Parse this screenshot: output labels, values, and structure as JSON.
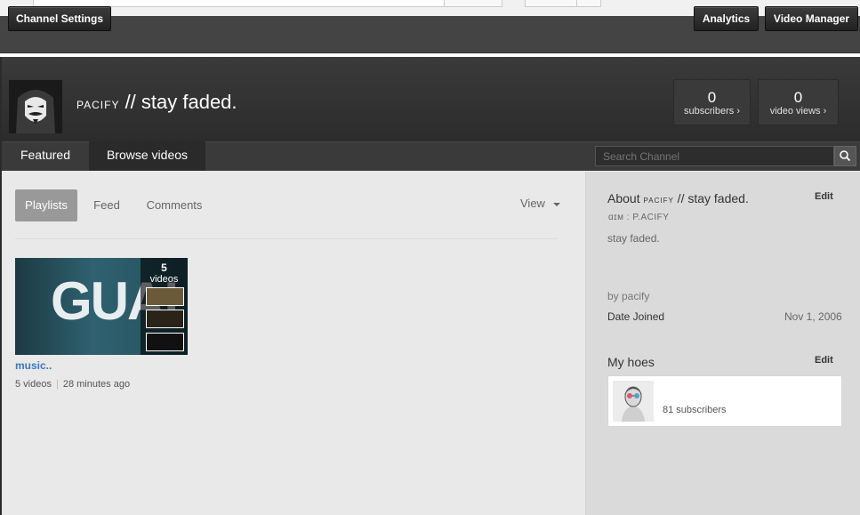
{
  "owner_bar": {
    "channel_settings": "Channel Settings",
    "analytics": "Analytics",
    "video_manager": "Video Manager"
  },
  "channel": {
    "name_smallcaps": "pacify",
    "name_rest": " // stay faded.",
    "subscribers": {
      "count": "0",
      "label": "subscribers ›"
    },
    "video_views": {
      "count": "0",
      "label": "video views ›"
    }
  },
  "nav": {
    "tabs": [
      {
        "label": "Featured"
      },
      {
        "label": "Browse videos"
      }
    ],
    "search_placeholder": "Search Channel"
  },
  "main": {
    "subtabs": [
      {
        "label": "Playlists"
      },
      {
        "label": "Feed"
      },
      {
        "label": "Comments"
      }
    ],
    "view_label": "View",
    "playlist": {
      "thumb_text": "GUAI",
      "count": "5",
      "count_label": "videos",
      "title": "music..",
      "videos": "5 videos",
      "age": "28 minutes ago"
    }
  },
  "sidebar": {
    "about_prefix": "About ",
    "about_smallcaps": "pacify",
    "about_rest": " // stay faded.",
    "about_edit": "Edit",
    "handle": "ɑɪᴍ : P.ACIFY",
    "description": "stay faded.",
    "by": "by pacify",
    "date_joined_label": "Date Joined",
    "date_joined_value": "Nov 1, 2006",
    "hoes_title": "My hoes",
    "hoes_edit": "Edit",
    "hoes_subscribers": "81 subscribers"
  },
  "colors": {
    "owner_bar_bg": "#444444",
    "header_bg": "#2c2c2c",
    "main_bg": "#e9e9e9",
    "sidebar_bg": "#dadada",
    "link": "#3a7ac1"
  }
}
